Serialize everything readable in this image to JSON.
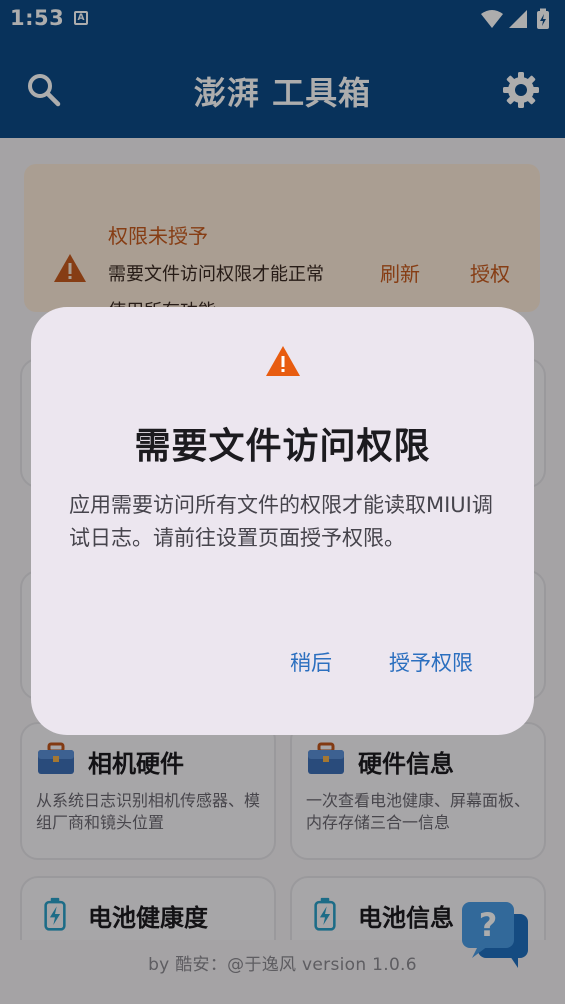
{
  "status_bar": {
    "time": "1:53",
    "notification_letter": "A"
  },
  "app_bar": {
    "title": "澎湃 工具箱"
  },
  "warning_card": {
    "title": "权限未授予",
    "description": "需要文件访问权限才能正常使用所有功能",
    "refresh_label": "刷新",
    "grant_label": "授权"
  },
  "cards": [
    {
      "title": "相机硬件",
      "description": "从系统日志识别相机传感器、模组厂商和镜头位置"
    },
    {
      "title": "硬件信息",
      "description": "一次查看电池健康、屏幕面板、内存存储三合一信息"
    },
    {
      "title": "电池健康度",
      "description": ""
    },
    {
      "title": "电池信息",
      "description": ""
    }
  ],
  "footer": {
    "text": "by 酷安：@于逸风 version 1.0.6"
  },
  "dialog": {
    "title": "需要文件访问权限",
    "body": "应用需要访问所有文件的权限才能读取MIUI调试日志。请前往设置页面授予权限。",
    "later_label": "稍后",
    "grant_label": "授予权限"
  },
  "colors": {
    "app_bar": "#0d4a86",
    "warning_accent": "#c65a1e",
    "dialog_button": "#2b6fbf",
    "warning_icon": "#e85c10"
  },
  "icons": {
    "search": "search-icon",
    "settings": "gear-icon",
    "warning": "warning-triangle-icon",
    "briefcase": "briefcase-icon",
    "battery": "battery-charging-icon",
    "help": "help-chat-icon"
  }
}
